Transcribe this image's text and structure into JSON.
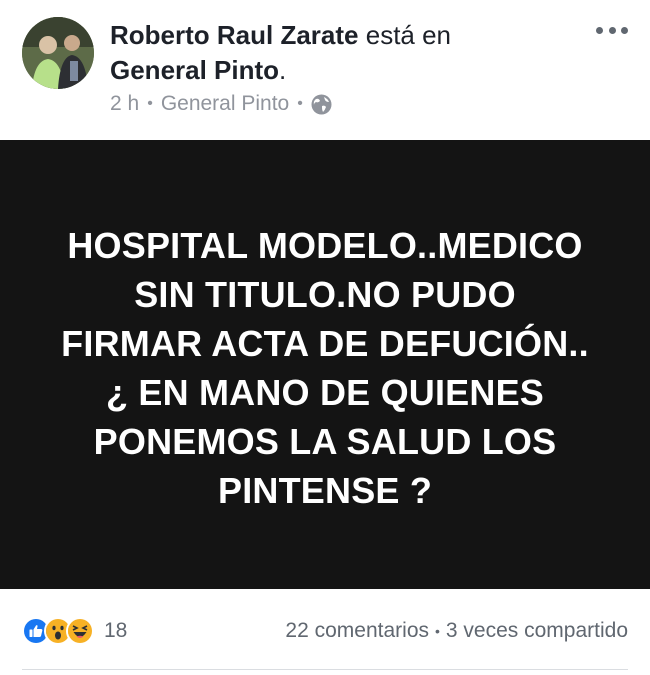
{
  "post": {
    "author": "Roberto Raul Zarate",
    "checkin_text": "está en",
    "place": "General Pinto",
    "place_suffix": ".",
    "time": "2 h",
    "location": "General Pinto",
    "privacy_icon": "globe-icon",
    "more_icon": "more-options-icon",
    "card_text": "HOSPITAL MODELO..MEDICO\nSIN TITULO.NO  PUDO\nFIRMAR ACTA DE DEFUCIÓN..\n¿ EN MANO DE QUIENES\nPONEMOS LA SALUD LOS\nPINTENSE ?",
    "card_background": "#141414"
  },
  "footer": {
    "reaction_icons": [
      "like-icon",
      "wow-icon",
      "haha-icon"
    ],
    "reaction_count": "18",
    "comments": "22 comentarios",
    "separator": "•",
    "shares": "3 veces compartido"
  },
  "colors": {
    "like_blue": "#1877f2",
    "emoji_yellow": "#f7b125",
    "muted_text": "#90949c"
  }
}
